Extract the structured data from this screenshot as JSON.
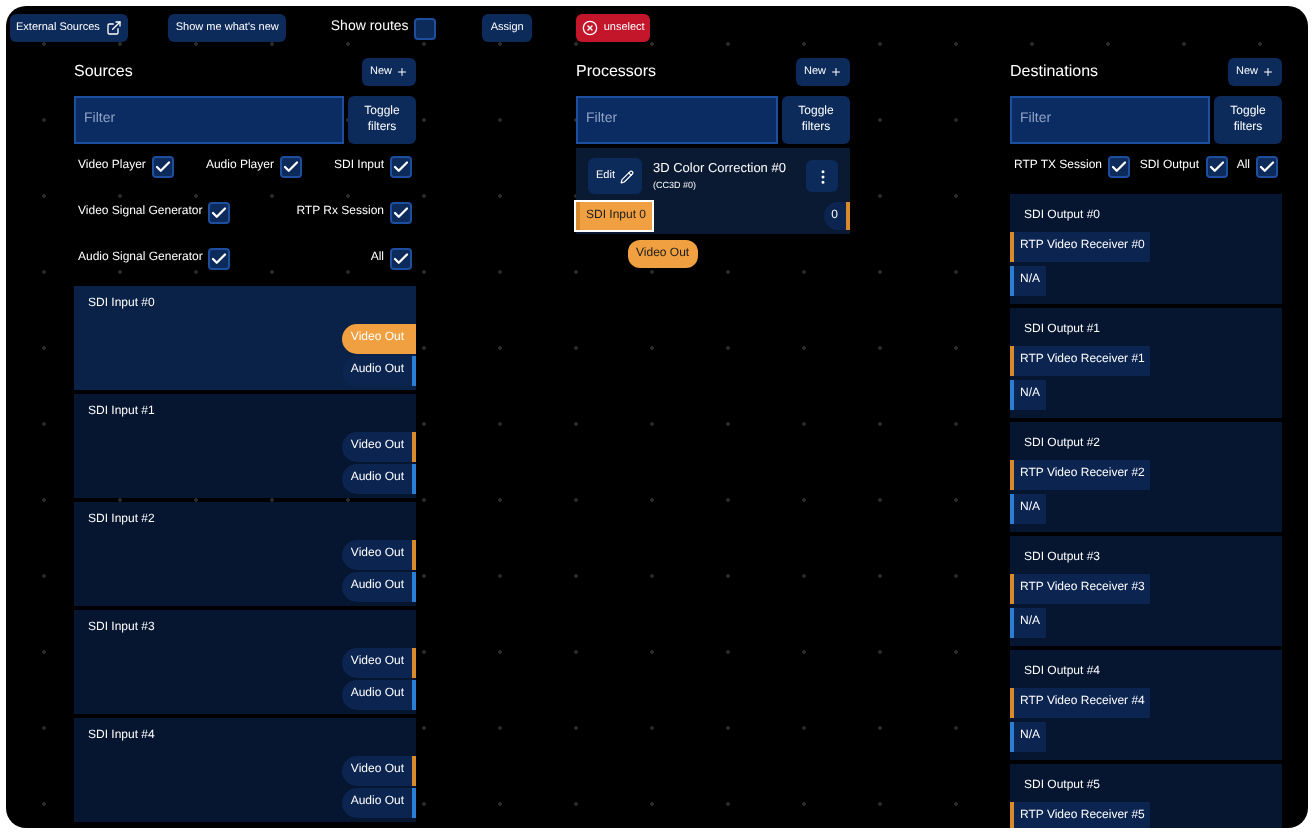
{
  "top_bar": {
    "external_sources": "External Sources",
    "whats_new": "Show me what's new",
    "show_routes": {
      "label": "Show routes",
      "checked": false
    },
    "assign": "Assign",
    "unselect": "unselect"
  },
  "sources": {
    "title": "Sources",
    "new_button": "New",
    "filter": {
      "placeholder": "Filter"
    },
    "toggle_filters": "Toggle filters",
    "filter_rows": [
      [
        {
          "label": "Video Player",
          "checked": true
        },
        {
          "label": "Audio Player",
          "checked": true
        },
        {
          "label": "SDI Input",
          "checked": true
        }
      ],
      [
        {
          "label": "Video Signal Generator",
          "checked": true
        },
        {
          "label": "RTP Rx Session",
          "checked": true
        }
      ],
      [
        {
          "label": "Audio Signal Generator",
          "checked": true
        },
        {
          "label": "All",
          "checked": true
        }
      ]
    ],
    "items": [
      {
        "name": "SDI Input #0",
        "selected": true,
        "ports": [
          {
            "label": "Video Out",
            "kind": "video",
            "selected": true
          },
          {
            "label": "Audio Out",
            "kind": "audio",
            "selected": false
          }
        ]
      },
      {
        "name": "SDI Input #1",
        "selected": false,
        "ports": [
          {
            "label": "Video Out",
            "kind": "video",
            "selected": false
          },
          {
            "label": "Audio Out",
            "kind": "audio",
            "selected": false
          }
        ]
      },
      {
        "name": "SDI Input #2",
        "selected": false,
        "ports": [
          {
            "label": "Video Out",
            "kind": "video",
            "selected": false
          },
          {
            "label": "Audio Out",
            "kind": "audio",
            "selected": false
          }
        ]
      },
      {
        "name": "SDI Input #3",
        "selected": false,
        "ports": [
          {
            "label": "Video Out",
            "kind": "video",
            "selected": false
          },
          {
            "label": "Audio Out",
            "kind": "audio",
            "selected": false
          }
        ]
      },
      {
        "name": "SDI Input #4",
        "selected": false,
        "ports": [
          {
            "label": "Video Out",
            "kind": "video",
            "selected": false
          },
          {
            "label": "Audio Out",
            "kind": "audio",
            "selected": false
          }
        ]
      }
    ]
  },
  "processors": {
    "title": "Processors",
    "new_button": "New",
    "filter": {
      "placeholder": "Filter"
    },
    "toggle_filters": "Toggle filters",
    "items": [
      {
        "edit": "Edit",
        "name": "3D Color Correction #0",
        "subtitle": "(CC3D #0)",
        "inputs": [
          {
            "label": "SDI Input 0",
            "kind": "video",
            "selected": true
          }
        ],
        "outputs": [
          {
            "label": "0",
            "kind": "video",
            "selected": false
          }
        ]
      }
    ],
    "drag_pill": "Video Out"
  },
  "destinations": {
    "title": "Destinations",
    "new_button": "New",
    "filter": {
      "placeholder": "Filter"
    },
    "toggle_filters": "Toggle filters",
    "filter_rows": [
      [
        {
          "label": "RTP TX Session",
          "checked": true
        },
        {
          "label": "SDI Output",
          "checked": true
        },
        {
          "label": "All",
          "checked": true
        }
      ]
    ],
    "items": [
      {
        "name": "SDI Output #0",
        "inputs": [
          {
            "label": "RTP Video Receiver #0",
            "kind": "video"
          },
          {
            "label": "N/A",
            "kind": "audio"
          }
        ]
      },
      {
        "name": "SDI Output #1",
        "inputs": [
          {
            "label": "RTP Video Receiver #1",
            "kind": "video"
          },
          {
            "label": "N/A",
            "kind": "audio"
          }
        ]
      },
      {
        "name": "SDI Output #2",
        "inputs": [
          {
            "label": "RTP Video Receiver #2",
            "kind": "video"
          },
          {
            "label": "N/A",
            "kind": "audio"
          }
        ]
      },
      {
        "name": "SDI Output #3",
        "inputs": [
          {
            "label": "RTP Video Receiver #3",
            "kind": "video"
          },
          {
            "label": "N/A",
            "kind": "audio"
          }
        ]
      },
      {
        "name": "SDI Output #4",
        "inputs": [
          {
            "label": "RTP Video Receiver #4",
            "kind": "video"
          },
          {
            "label": "N/A",
            "kind": "audio"
          }
        ]
      },
      {
        "name": "SDI Output #5",
        "inputs": [
          {
            "label": "RTP Video Receiver #5",
            "kind": "video"
          }
        ]
      }
    ]
  }
}
